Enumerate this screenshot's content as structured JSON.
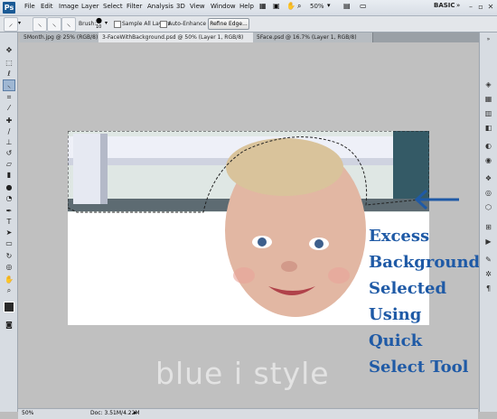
{
  "app": {
    "logo": "Ps"
  },
  "menubar": {
    "items": [
      "File",
      "Edit",
      "Image",
      "Layer",
      "Select",
      "Filter",
      "Analysis",
      "3D",
      "View",
      "Window",
      "Help"
    ],
    "zoom": "50%",
    "workspace": "BASIC"
  },
  "options": {
    "brush_label": "Brush:",
    "brush_size": "10",
    "sample_all_layers": "Sample All Layers",
    "auto_enhance": "Auto-Enhance",
    "refine_edge": "Refine Edge..."
  },
  "tabs": [
    {
      "label": "5Month.jpg @ 25% (RGB/8)"
    },
    {
      "label": "3-FaceWithBackground.psd @ 50% (Layer 1, RGB/8)"
    },
    {
      "label": "5Face.psd @ 16.7% (Layer 1, RGB/8)"
    }
  ],
  "status": {
    "zoom": "50%",
    "doc": "Doc: 3.51M/4.22M"
  },
  "annotation": {
    "lines": [
      "Excess",
      "Background",
      "Selected",
      "Using",
      "Quick",
      "Select Tool"
    ],
    "color": "#1f5aa6"
  },
  "watermark": "blue i style",
  "icons": [
    "move-icon",
    "marquee-icon",
    "lasso-icon",
    "quick-select-icon",
    "crop-icon",
    "eyedropper-icon",
    "heal-icon",
    "brush-icon",
    "stamp-icon",
    "history-brush-icon",
    "eraser-icon",
    "gradient-icon",
    "blur-icon",
    "dodge-icon",
    "pen-icon",
    "type-icon",
    "path-select-icon",
    "shape-icon",
    "hand-icon",
    "zoom-icon"
  ]
}
